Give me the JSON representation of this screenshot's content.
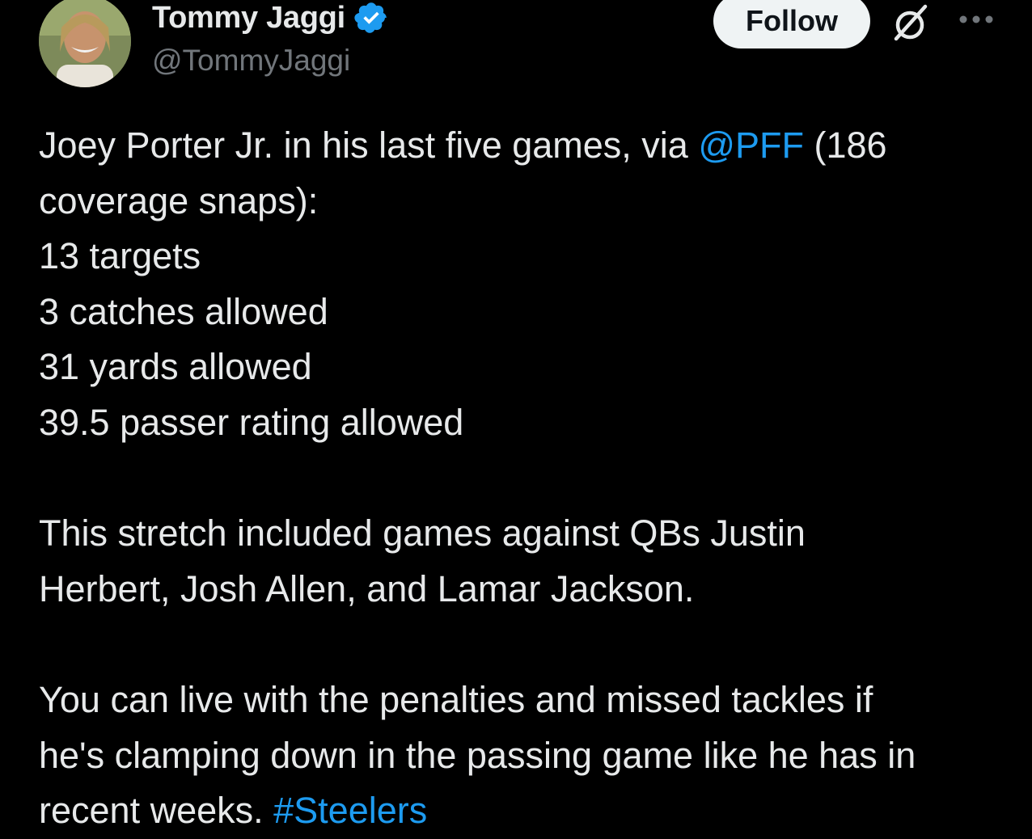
{
  "author": {
    "display_name": "Tommy Jaggi",
    "handle": "@TommyJaggi",
    "verified": true,
    "verified_badge_color": "#1d9bf0"
  },
  "actions": {
    "follow_label": "Follow",
    "grok_icon": "grok-icon",
    "more_icon": "more-horizontal-icon"
  },
  "tweet": {
    "line1_prefix": "Joey Porter Jr. in his last five games, via ",
    "line1_mention": "@PFF",
    "line1_suffix": " (186",
    "line2": "coverage snaps):",
    "line3": "13 targets",
    "line4": "3 catches allowed",
    "line5": "31 yards allowed",
    "line6": "39.5 passer rating allowed",
    "line8": "This stretch included games against QBs Justin",
    "line9": "Herbert, Josh Allen, and Lamar Jackson.",
    "line11": "You can live with the penalties and missed tackles if",
    "line12": "he's clamping down in the passing game like he has in",
    "line13_prefix": "recent weeks. ",
    "line13_hashtag": "#Steelers"
  },
  "colors": {
    "background": "#000000",
    "text": "#e7e9ea",
    "secondary_text": "#71767b",
    "link": "#1d9bf0",
    "follow_bg": "#eff3f4"
  }
}
